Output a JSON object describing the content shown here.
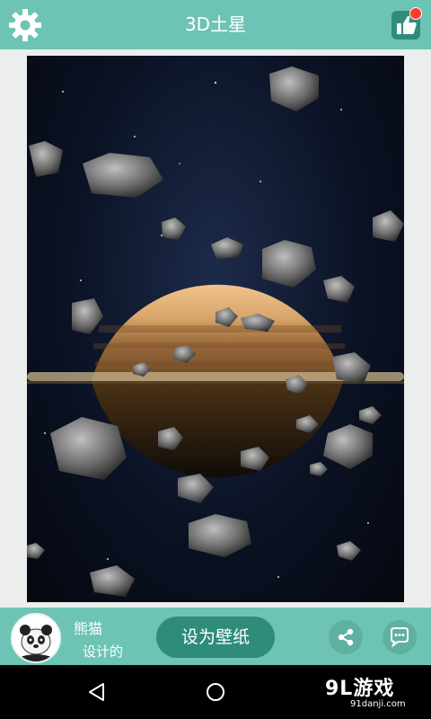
{
  "header": {
    "title": "3D土星",
    "settings_icon": "gear-icon",
    "like_icon": "thumbs-up-icon",
    "accent_color": "#6ec4b4",
    "badge_color": "#ff3b30"
  },
  "wallpaper_preview": {
    "description": "saturn-with-asteroids",
    "planet_color": "#d7a46a"
  },
  "footer": {
    "author_name": "熊猫",
    "author_desc": "设计的",
    "set_wallpaper_label": "设为壁纸",
    "share_icon": "share-icon",
    "comment_icon": "comment-icon",
    "button_color": "#2f8c7a"
  },
  "navbar": {
    "back_icon": "back-triangle-icon",
    "home_icon": "home-circle-icon"
  },
  "watermark": {
    "main": "9L游戏",
    "sub": "91danji.com"
  }
}
